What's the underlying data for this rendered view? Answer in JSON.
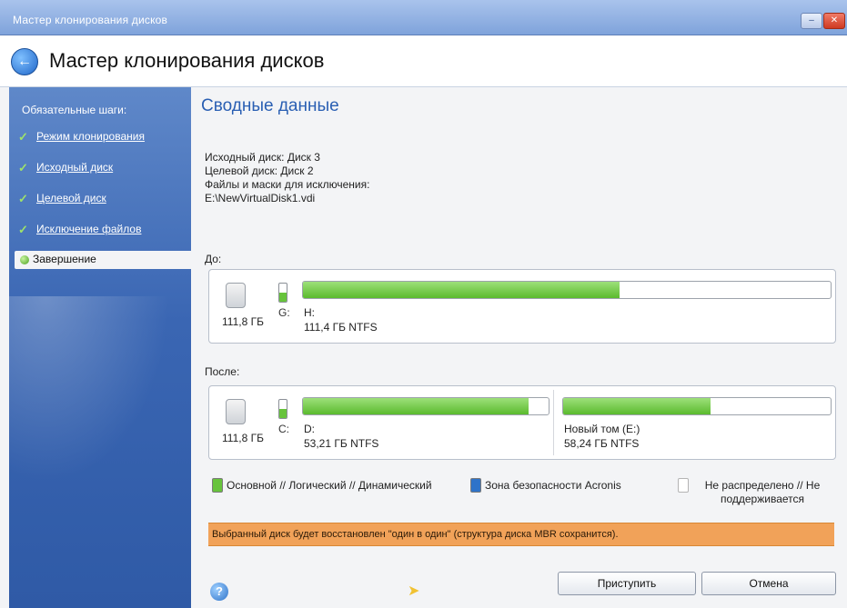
{
  "window": {
    "title": "Мастер клонирования дисков"
  },
  "header": {
    "title": "Мастер клонирования дисков"
  },
  "sidebar": {
    "heading": "Обязательные шаги:",
    "items": [
      {
        "label": "Режим клонирования",
        "done": true
      },
      {
        "label": "Исходный диск",
        "done": true
      },
      {
        "label": "Целевой диск",
        "done": true
      },
      {
        "label": "Исключение файлов",
        "done": true
      },
      {
        "label": "Завершение",
        "active": true
      }
    ]
  },
  "content": {
    "title": "Сводные данные",
    "summary": [
      "Исходный диск: Диск 3",
      "Целевой диск: Диск 2",
      "Файлы и маски для исключения:",
      "E:\\NewVirtualDisk1.vdi"
    ],
    "before": {
      "label": "До:",
      "disk_size": "111,8 ГБ",
      "tiny_letter": "G:",
      "tiny_fill": 0.5,
      "partitions": [
        {
          "name": "H:",
          "size": "111,4 ГБ  NTFS",
          "used_fraction": 0.6
        }
      ]
    },
    "after": {
      "label": "После:",
      "disk_size": "111,8 ГБ",
      "tiny_letter": "C:",
      "tiny_fill": 0.5,
      "partitions": [
        {
          "name": "D:",
          "size": "53,21 ГБ  NTFS",
          "used_fraction": 0.92
        },
        {
          "name": "Новый том (E:)",
          "size": "58,24 ГБ  NTFS",
          "used_fraction": 0.55
        }
      ]
    },
    "legend": {
      "primary": "Основной // Логический // Динамический",
      "acronis": "Зона безопасности Acronis",
      "unallocated": "Не распределено // Не поддерживается"
    },
    "warning": "Выбранный диск будет восстановлен \"один в один\" (структура диска MBR сохранится)."
  },
  "buttons": {
    "proceed": "Приступить",
    "cancel": "Отмена"
  },
  "colors": {
    "used": "#67c33c",
    "acronis": "#2f73c9",
    "warning_bg": "#f1a259",
    "accent": "#2a5fb3"
  }
}
